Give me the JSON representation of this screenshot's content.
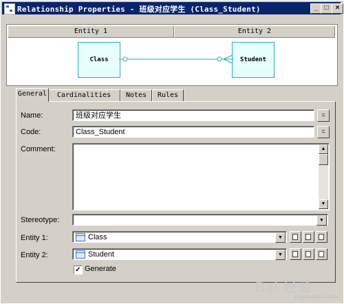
{
  "window": {
    "title": "Relationship Properties - 班级对应学生 (Class_Student)",
    "controls": {
      "minimize": "_",
      "maximize": "□",
      "close": "×"
    }
  },
  "diagram": {
    "entity1_header": "Entity 1",
    "entity2_header": "Entity 2",
    "entity1_name": "Class",
    "entity2_name": "Student",
    "line_color": "#20b0b0"
  },
  "tabs": [
    {
      "label": "General",
      "active": true
    },
    {
      "label": "Cardinalities",
      "active": false
    },
    {
      "label": "Notes",
      "active": false
    },
    {
      "label": "Rules",
      "active": false
    }
  ],
  "form": {
    "name_label": "Name:",
    "name_value": "班级对应学生",
    "code_label": "Code:",
    "code_value": "Class_Student",
    "edit_button": "=",
    "comment_label": "Comment:",
    "comment_value": "",
    "stereotype_label": "Stereotype:",
    "stereotype_value": "",
    "entity1_label": "Entity 1:",
    "entity1_value": "Class",
    "entity2_label": "Entity 2:",
    "entity2_value": "Student",
    "generate_label": "Generate",
    "generate_checked": true
  },
  "icons": [
    "table-icon",
    "new-icon",
    "properties-icon",
    "copy-icon"
  ],
  "watermark": {
    "text": "Bai 经验",
    "sub": "jingyan.baidu.com"
  }
}
